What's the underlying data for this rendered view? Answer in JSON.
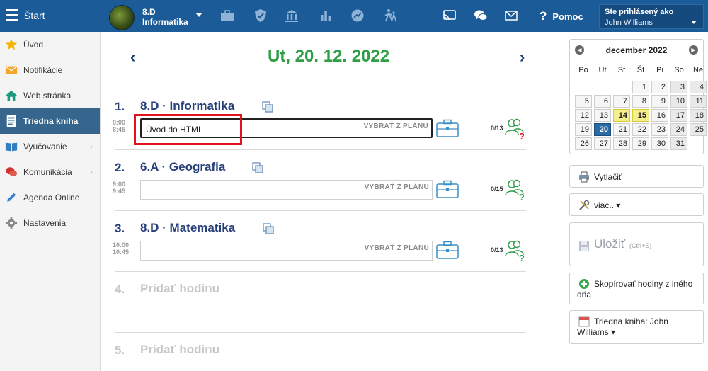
{
  "topbar": {
    "start_label": "Štart",
    "class_name": "8.D",
    "class_subject": "Informatika",
    "help_label": "Pomoc",
    "user_label": "Ste prihlásený ako",
    "user_name": "John Williams"
  },
  "sidebar": {
    "items": [
      {
        "label": "Úvod",
        "icon": "star-icon"
      },
      {
        "label": "Notifikácie",
        "icon": "envelope-icon"
      },
      {
        "label": "Web stránka",
        "icon": "home-icon"
      },
      {
        "label": "Triedna kniha",
        "icon": "notebook-icon",
        "active": true
      },
      {
        "label": "Vyučovanie",
        "icon": "book-icon",
        "has_children": true
      },
      {
        "label": "Komunikácia",
        "icon": "chat-icon",
        "has_children": true
      },
      {
        "label": "Agenda Online",
        "icon": "pen-icon"
      },
      {
        "label": "Nastavenia",
        "icon": "gear-icon"
      }
    ]
  },
  "main": {
    "date": "Ut, 20. 12. 2022",
    "prev_arrow": "‹",
    "next_arrow": "›",
    "lessons": [
      {
        "num": "1.",
        "title": "8.D · Informatika",
        "start": "8:00",
        "end": "8:45",
        "topic": "Úvod do HTML",
        "plan_label": "VYBRAŤ Z PLÁNU",
        "attendance": "0/13",
        "att_mark": "?"
      },
      {
        "num": "2.",
        "title": "6.A · Geografia",
        "start": "9:00",
        "end": "9:45",
        "topic": "",
        "plan_label": "VYBRAŤ Z PLÁNU",
        "attendance": "0/15",
        "att_mark": "?"
      },
      {
        "num": "3.",
        "title": "8.D · Matematika",
        "start": "10:00",
        "end": "10:45",
        "topic": "",
        "plan_label": "VYBRAŤ Z PLÁNU",
        "attendance": "0/13",
        "att_mark": "?"
      },
      {
        "num": "4.",
        "title": "Pridať hodinu"
      },
      {
        "num": "5.",
        "title": "Pridať hodinu"
      }
    ]
  },
  "calendar": {
    "title": "december 2022",
    "weekdays": [
      "Po",
      "Ut",
      "St",
      "Št",
      "Pi",
      "So",
      "Ne"
    ],
    "weeks": [
      [
        "",
        "",
        "",
        "1",
        "2",
        "3",
        "4"
      ],
      [
        "5",
        "6",
        "7",
        "8",
        "9",
        "10",
        "11"
      ],
      [
        "12",
        "13",
        "14",
        "15",
        "16",
        "17",
        "18"
      ],
      [
        "19",
        "20",
        "21",
        "22",
        "23",
        "24",
        "25"
      ],
      [
        "26",
        "27",
        "28",
        "29",
        "30",
        "31",
        ""
      ]
    ],
    "selected_day": "20",
    "highlighted_days": [
      "14",
      "15"
    ]
  },
  "actions": {
    "print_label": "Vytlačiť",
    "more_label": "viac.. ▾",
    "save_label": "Uložiť",
    "save_shortcut": "(Ctrl+S)",
    "copy_line1": "Skopírovať hodiny z iného",
    "copy_line2": "dňa",
    "book_line1": "Triedna kniha: John",
    "book_line2": "Williams ▾"
  }
}
